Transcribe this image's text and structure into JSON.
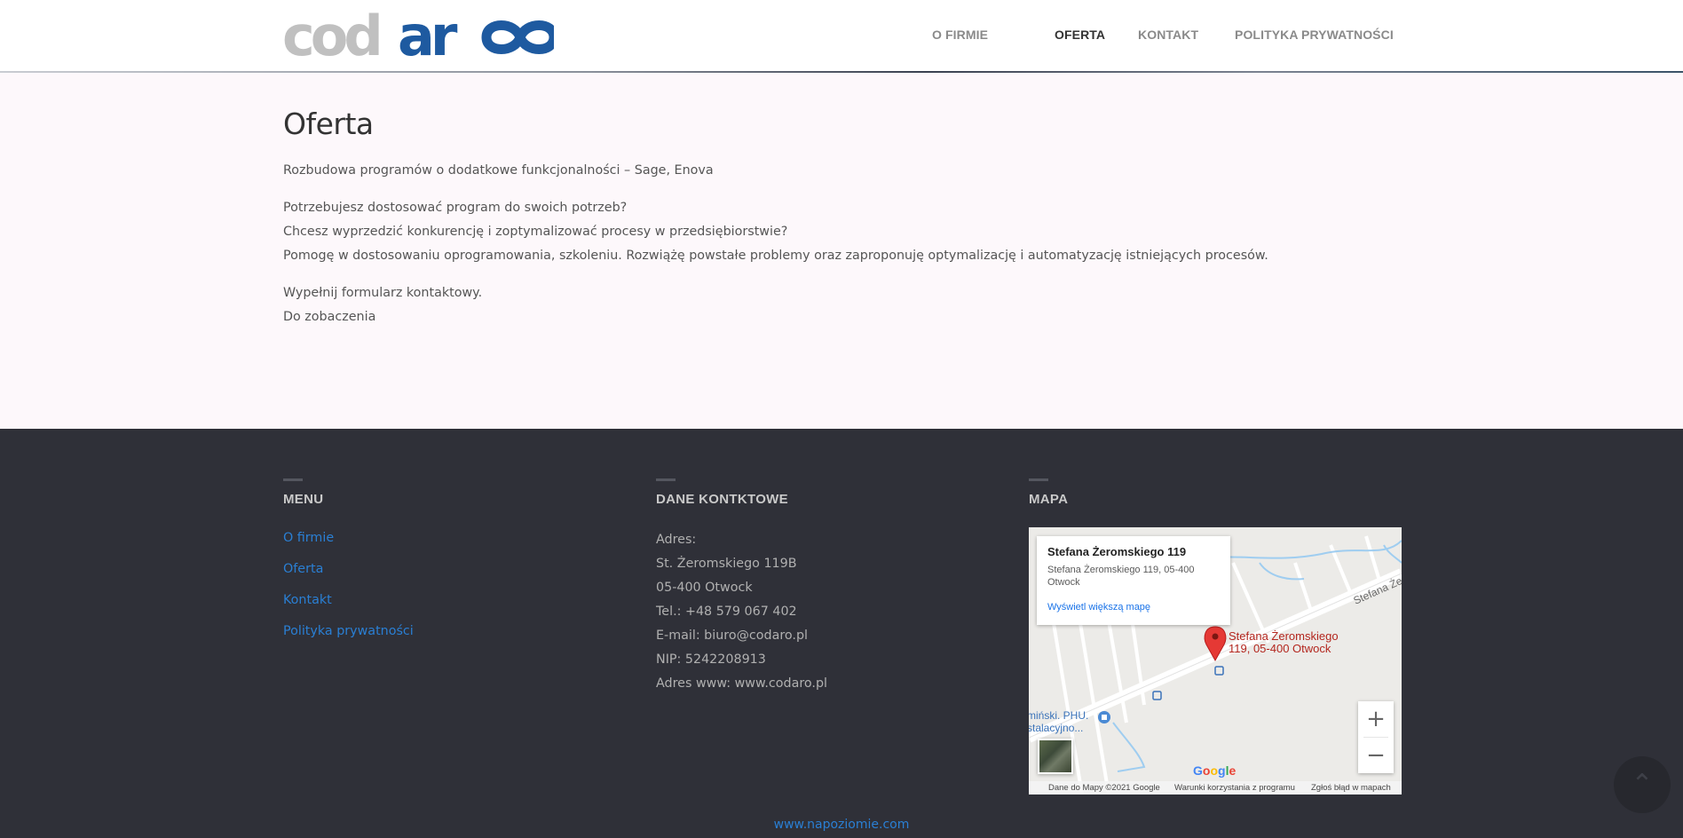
{
  "brand": {
    "logo_text": "codaro",
    "logo_gray": "#c0c0c0",
    "logo_blue": "#1e5aa0"
  },
  "nav": [
    {
      "label": "O FIRMIE",
      "active": false
    },
    {
      "label": "OFERTA",
      "active": true
    },
    {
      "label": "KONTAKT",
      "active": false
    },
    {
      "label": "POLITYKA PRYWATNOŚCI",
      "active": false
    }
  ],
  "main": {
    "title": "Oferta",
    "paragraphs": [
      [
        "Rozbudowa programów o dodatkowe funkcjonalności – Sage, Enova"
      ],
      [
        "Potrzebujesz dostosować program do swoich potrzeb?",
        "Chcesz wyprzedzić konkurencję i zoptymalizować procesy w przedsiębiorstwie?",
        "Pomogę w dostosowaniu oprogramowania, szkoleniu. Rozwiążę powstałe problemy oraz zaproponuję optymalizację i automatyzację istniejących procesów."
      ],
      [
        "Wypełnij formularz kontaktowy.",
        "Do zobaczenia"
      ]
    ]
  },
  "footer": {
    "menu_title": "MENU",
    "menu_items": [
      "O firmie",
      "Oferta",
      "Kontakt",
      "Polityka prywatności"
    ],
    "contact_title": "DANE KONTKTOWE",
    "contact_lines": [
      "Adres:",
      "St. Żeromskiego 119B",
      "05-400 Otwock",
      "Tel.: +48 579 067 402",
      "E-mail: biuro@codaro.pl",
      "NIP: 5242208913",
      "Adres www: www.codaro.pl"
    ],
    "map_title": "MAPA",
    "credit": "www.napoziomie.com"
  },
  "map": {
    "card_title": "Stefana Żeromskiego 119",
    "card_address": "Stefana Żeromskiego 119, 05-400 Otwock",
    "card_link": "Wyświetl większą mapę",
    "pin_label": "Stefana Żeromskiego 119, 05-400 Otwock",
    "street_label": "Stefana Że",
    "poi_label": "miński. PHU. stalacyjno...",
    "zoom_in": "+",
    "zoom_out": "−",
    "google": "Google",
    "attribution": "Dane do Mapy ©2021 Google",
    "terms": "Warunki korzystania z programu",
    "report": "Zgłoś błąd w mapach"
  },
  "colors": {
    "accent_link": "#2a7fd4",
    "footer_bg": "#2f3038",
    "pin_red": "#e53935"
  },
  "icons": {
    "scroll_top": "chevron-up-icon",
    "map_pin": "map-pin-icon",
    "poi": "shopping-bag-icon"
  }
}
